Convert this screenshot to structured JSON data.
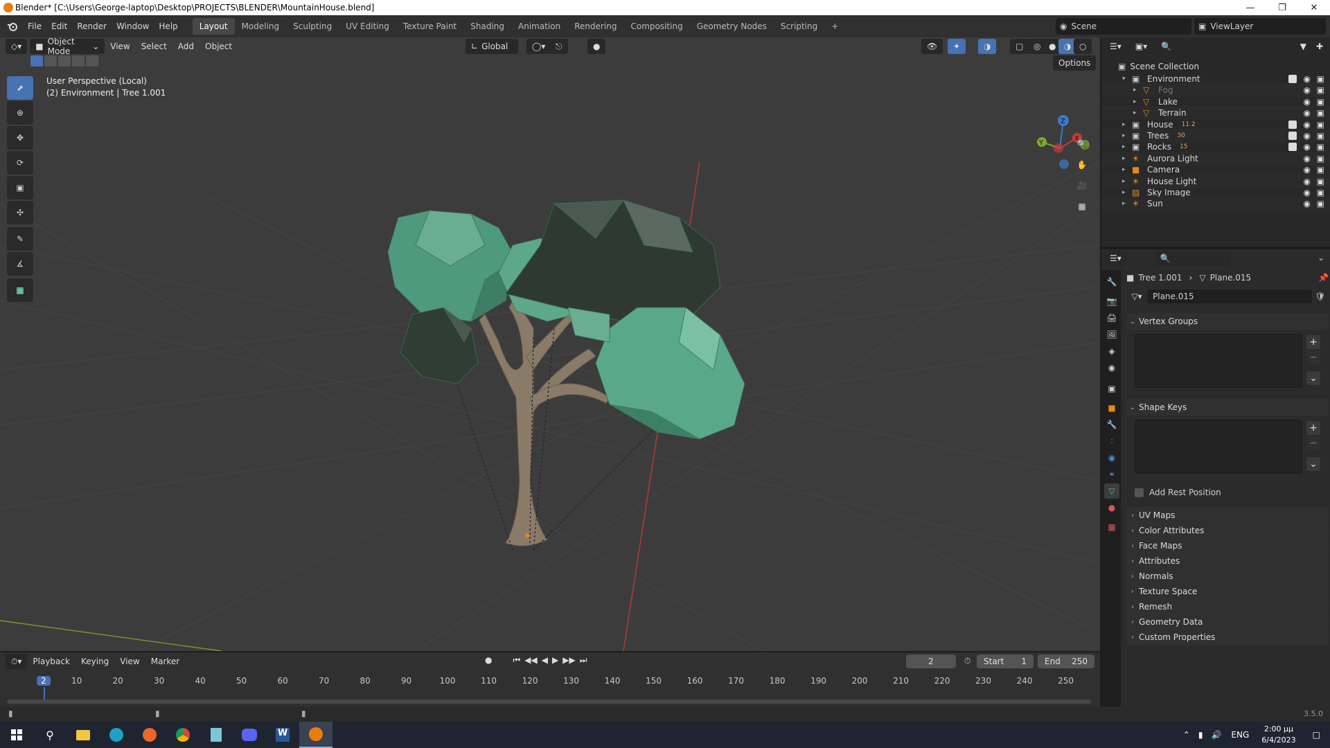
{
  "window": {
    "title": "Blender* [C:\\Users\\George-laptop\\Desktop\\PROJECTS\\BLENDER\\MountainHouse.blend]",
    "controls": [
      "minimize",
      "restore",
      "close"
    ]
  },
  "menubar": {
    "items": [
      "File",
      "Edit",
      "Render",
      "Window",
      "Help"
    ]
  },
  "workspaces": {
    "tabs": [
      "Layout",
      "Modeling",
      "Sculpting",
      "UV Editing",
      "Texture Paint",
      "Shading",
      "Animation",
      "Rendering",
      "Compositing",
      "Geometry Nodes",
      "Scripting"
    ],
    "active": "Layout"
  },
  "scene": {
    "name": "Scene",
    "view_layer": "ViewLayer"
  },
  "viewport": {
    "mode": "Object Mode",
    "menus": [
      "View",
      "Select",
      "Add",
      "Object"
    ],
    "orientation": "Global",
    "options_label": "Options",
    "overlay_line1": "User Perspective (Local)",
    "overlay_line2": "(2) Environment | Tree 1.001",
    "gizmo": {
      "x": "X",
      "y": "Y",
      "z": "Z"
    },
    "colors": {
      "background": "#3c3c3c",
      "foliage": "#4f9a7e",
      "foliage_dark": "#2d3a30",
      "trunk": "#8a7a68",
      "x_axis": "#b83a3a",
      "y_axis": "#7a9a2a"
    }
  },
  "outliner": {
    "root": "Scene Collection",
    "items": [
      {
        "name": "Environment",
        "indent": 1,
        "expanded": true,
        "icon": "collection-icon"
      },
      {
        "name": "Fog",
        "indent": 2,
        "icon": "mesh-icon",
        "dimmed": true
      },
      {
        "name": "Lake",
        "indent": 2,
        "icon": "mesh-icon"
      },
      {
        "name": "Terrain",
        "indent": 2,
        "icon": "mesh-icon"
      },
      {
        "name": "House",
        "indent": 1,
        "icon": "collection-icon",
        "badge": "11  2"
      },
      {
        "name": "Trees",
        "indent": 1,
        "icon": "collection-icon",
        "badge": "30"
      },
      {
        "name": "Rocks",
        "indent": 1,
        "icon": "collection-icon",
        "badge": "15"
      },
      {
        "name": "Aurora Light",
        "indent": 1,
        "icon": "light-icon"
      },
      {
        "name": "Camera",
        "indent": 1,
        "icon": "camera-icon"
      },
      {
        "name": "House Light",
        "indent": 1,
        "icon": "light-icon"
      },
      {
        "name": "Sky Image",
        "indent": 1,
        "icon": "image-icon"
      },
      {
        "name": "Sun",
        "indent": 1,
        "icon": "sun-icon"
      }
    ]
  },
  "properties": {
    "breadcrumb_object": "Tree 1.001",
    "breadcrumb_mesh": "Plane.015",
    "mesh_name": "Plane.015",
    "vertex_groups": "Vertex Groups",
    "shape_keys": "Shape Keys",
    "add_rest_position": "Add Rest Position",
    "sections": [
      "UV Maps",
      "Color Attributes",
      "Face Maps",
      "Attributes",
      "Normals",
      "Texture Space",
      "Remesh",
      "Geometry Data",
      "Custom Properties"
    ]
  },
  "timeline": {
    "menus": [
      "Playback",
      "Keying",
      "View",
      "Marker"
    ],
    "current_frame": "2",
    "start_label": "Start",
    "start": "1",
    "end_label": "End",
    "end": "250",
    "ticks": [
      "2",
      "10",
      "20",
      "30",
      "40",
      "50",
      "60",
      "70",
      "80",
      "90",
      "100",
      "110",
      "120",
      "130",
      "140",
      "150",
      "160",
      "170",
      "180",
      "190",
      "200",
      "210",
      "220",
      "230",
      "240",
      "250"
    ]
  },
  "status": {
    "version": "3.5.0"
  },
  "taskbar": {
    "apps": [
      "start-icon",
      "search-icon",
      "file-explorer-icon",
      "edge-icon",
      "firefox-icon",
      "chrome-icon",
      "notepad-icon",
      "discord-icon",
      "word-icon",
      "blender-icon"
    ],
    "language": "ENG",
    "time": "2:00 μμ",
    "date": "6/4/2023"
  }
}
